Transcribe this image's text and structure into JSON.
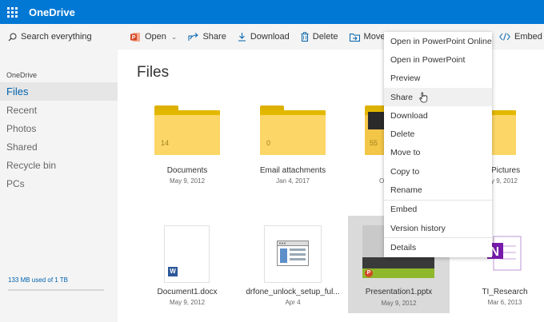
{
  "app": {
    "name": "OneDrive"
  },
  "search": {
    "placeholder": "Search everything"
  },
  "sidebar": {
    "heading": "OneDrive",
    "items": [
      {
        "label": "Files",
        "active": true
      },
      {
        "label": "Recent"
      },
      {
        "label": "Photos"
      },
      {
        "label": "Shared"
      },
      {
        "label": "Recycle bin"
      },
      {
        "label": "PCs"
      }
    ],
    "quota": "133 MB used of 1 TB"
  },
  "toolbar": {
    "open": "Open",
    "share": "Share",
    "download": "Download",
    "delete": "Delete",
    "move_to": "Move to",
    "embed": "Embed"
  },
  "main": {
    "title": "Files",
    "items": [
      {
        "name": "Documents",
        "date": "May 9, 2012",
        "count": "14",
        "kind": "folder"
      },
      {
        "name": "Email attachments",
        "date": "Jan 4, 2017",
        "count": "0",
        "kind": "folder"
      },
      {
        "name": "",
        "date": "O",
        "count": "55",
        "kind": "folder"
      },
      {
        "name": "Pictures",
        "date": "y 9, 2012",
        "kind": "folder"
      },
      {
        "name": "Document1.docx",
        "date": "May 9, 2012",
        "kind": "docx"
      },
      {
        "name": "drfone_unlock_setup_ful...",
        "date": "Apr 4",
        "kind": "exe"
      },
      {
        "name": "Presentation1.pptx",
        "date": "May 9, 2012",
        "kind": "pptx",
        "selected": true
      },
      {
        "name": "TI_Research",
        "date": "Mar 6, 2013",
        "kind": "onenote"
      }
    ]
  },
  "context_menu": {
    "items": [
      "Open in PowerPoint Online",
      "Open in PowerPoint",
      "Preview",
      "Share",
      "Download",
      "Delete",
      "Move to",
      "Copy to",
      "Rename",
      "Embed",
      "Version history",
      "Details"
    ],
    "hovered": "Share"
  },
  "colors": {
    "brand": "#0078d4",
    "link": "#0062ad",
    "folder": "#fcd767",
    "powerpoint": "#d24726",
    "word": "#2b579a",
    "onenote": "#7719aa"
  }
}
